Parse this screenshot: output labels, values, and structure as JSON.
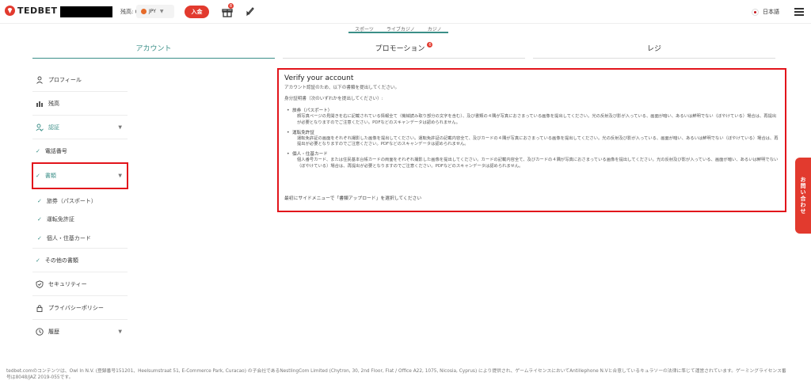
{
  "header": {
    "logo_text": "TEDBET",
    "balance_label": "残高: 0",
    "currency": "JPY",
    "deposit_label": "入金",
    "gift_badge": "8",
    "language": "日本語"
  },
  "mini_tabs": [
    {
      "label": "スポーツ"
    },
    {
      "label": "ライブカジノ"
    },
    {
      "label": "カジノ"
    }
  ],
  "section_tabs": {
    "account": "アカウント",
    "promotion": "プロモーション",
    "promotion_badge": "6",
    "register": "レジ"
  },
  "sidebar": {
    "profile": "プロフィール",
    "balance": "残高",
    "verification": "認証",
    "phone": "電話番号",
    "documents": "書類",
    "passport": "旅券（パスポート）",
    "license": "運転免許証",
    "personal_card": "個人・住基カード",
    "other_docs": "その他の書類",
    "security": "セキュリティー",
    "privacy": "プライバシーポリシー",
    "history": "履歴"
  },
  "verify": {
    "title": "Verify your account",
    "intro": "アカウント認証のため、以下の書類を提出してください。",
    "id_proof": "身分証明書（次のいずれかを提出してください）:",
    "items": [
      {
        "name": "旅券（パスポート）",
        "desc": "顔写真ページの見開きを右に記載されている情報全て（機械読み取り部分の文字を含む）、及び書類の４隅が写真におさまっている画像を提出してください。光の反射及び影が入っている、画面が暗い、あるいは鮮明でない（ぼやけている）場合は、再提出が必要となりますのでご注意ください。PDFなどのスキャンデータは認められません。"
      },
      {
        "name": "運転免許証",
        "desc": "運転免許証の画面をそれぞれ撮影した画像を提出してください。運転免許証の記載内容全て、及びカードの４隅が写真におさまっている画像を提出してください。光の反射及び影が入っている、画面が暗い、あるいは鮮明でない（ぼやけている）場合は、再提出が必要となりますのでご注意ください。PDFなどのスキャンデータは認められません。"
      },
      {
        "name": "個人・住基カード",
        "desc": "個人番号カード、または住民基本台帳カードの両面をそれぞれ撮影した画像を提出してください。カードの記載内容全て、及びカードの４隅が写真におさまっている画像を提出してください。光の反射及び影が入っている、画面が暗い、あるいは鮮明でない（ぼやけている）場合は、再提出が必要となりますのでご注意ください。PDFなどのスキャンデータは認められません。"
      }
    ],
    "footer": "最初にサイドメニューで「書類アップロード」を選択してください"
  },
  "contact_tab": "お問い合わせ",
  "footer_text": "tedbet.comのコンテンツは、Owl In N.V. (登録番号151201、Heelsumstraat 51, E-Commerce Park, Curacao) の子会社であるNestlingCom Limited (Chytron, 30, 2nd Floor, Flat / Office A22, 1075, Nicosia, Cyprus) により提供され、ゲームライセンスにおいてAntillephone N.Vと合意しているキュラソーの法律に準じて運営されています。ゲーミングライセンス番号は8048/JAZ 2019-055です。",
  "colors": {
    "accent": "#3b8f88",
    "brand_red": "#e23a2e",
    "highlight": "#e2141b"
  }
}
